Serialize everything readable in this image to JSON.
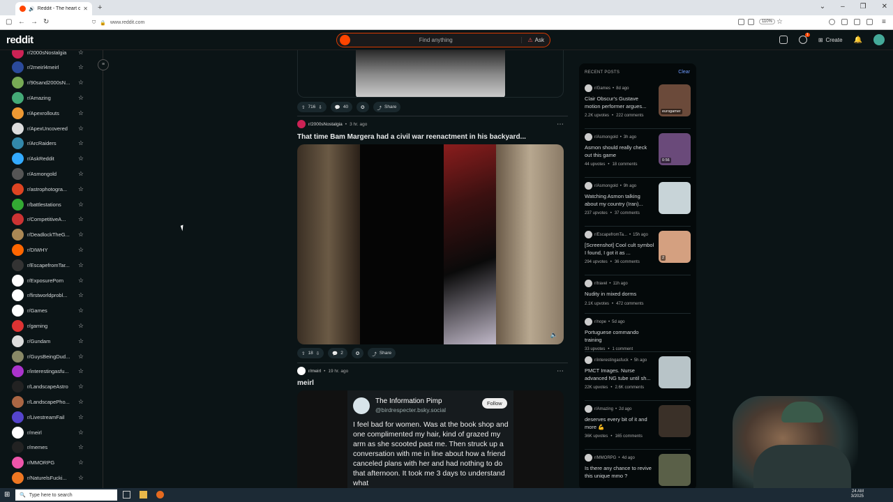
{
  "browser": {
    "tab_title": "Reddit - The heart of the in",
    "url": "www.reddit.com",
    "zoom": "110%"
  },
  "header": {
    "logo": "reddit",
    "search_placeholder": "Find anything",
    "ask_label": "Ask",
    "create_label": "Create",
    "chat_badge": "1"
  },
  "sidebar": {
    "items": [
      {
        "label": "r/2000sNostalgia",
        "color": "#c25"
      },
      {
        "label": "r/2meirl4meirl",
        "color": "#2b4a9b"
      },
      {
        "label": "r/90sand2000sN...",
        "color": "#7a5"
      },
      {
        "label": "r/Amazing",
        "color": "#4a7"
      },
      {
        "label": "r/Apexrollouts",
        "color": "#e93"
      },
      {
        "label": "r/ApexUncovered",
        "color": "#ddd"
      },
      {
        "label": "r/ArcRaiders",
        "color": "#38a"
      },
      {
        "label": "r/AskReddit",
        "color": "#3af"
      },
      {
        "label": "r/Asmongold",
        "color": "#555"
      },
      {
        "label": "r/astrophotogra...",
        "color": "#d42"
      },
      {
        "label": "r/battlestations",
        "color": "#3a3"
      },
      {
        "label": "r/CompetitiveA...",
        "color": "#c33"
      },
      {
        "label": "r/DeadlockTheG...",
        "color": "#a85"
      },
      {
        "label": "r/DIWHY",
        "color": "#f60"
      },
      {
        "label": "r/EscapefromTar...",
        "color": "#333"
      },
      {
        "label": "r/ExposurePorn",
        "color": "#fff"
      },
      {
        "label": "r/firstworldprobl...",
        "color": "#fff"
      },
      {
        "label": "r/Games",
        "color": "#fff"
      },
      {
        "label": "r/gaming",
        "color": "#d33"
      },
      {
        "label": "r/Gundam",
        "color": "#ddd"
      },
      {
        "label": "r/GuysBeingDud...",
        "color": "#886"
      },
      {
        "label": "r/interestingasfu...",
        "color": "#a3c"
      },
      {
        "label": "r/LandscapeAstro",
        "color": "#222"
      },
      {
        "label": "r/LandscapePho...",
        "color": "#a64"
      },
      {
        "label": "r/LivestreamFail",
        "color": "#54c"
      },
      {
        "label": "r/meirl",
        "color": "#fff"
      },
      {
        "label": "r/memes",
        "color": "#222"
      },
      {
        "label": "r/MMORPG",
        "color": "#e5a"
      },
      {
        "label": "r/NaturelsFucki...",
        "color": "#e72"
      }
    ]
  },
  "feed": {
    "post1": {
      "upvotes": "716",
      "comments": "40",
      "share": "Share"
    },
    "post2": {
      "subreddit": "r/2000sNostalgia",
      "time": "3 hr. ago",
      "title": "That time Bam Margera had a civil war reenactment in his backyard...",
      "upvotes": "18",
      "comments": "2",
      "share": "Share"
    },
    "post3": {
      "subreddit": "r/meirl",
      "time": "19 hr. ago",
      "title": "meirl",
      "tweet_name": "The Information Pimp",
      "tweet_handle": "@birdrespecter.bsky.social",
      "follow": "Follow",
      "tweet_text": "I feel bad for women. Was at the book shop and one complimented my hair, kind of grazed my arm as she scooted past me. Then struck up a conversation with me in line about how a friend canceled plans with her and had nothing to do that afternoon. It took me 3 days to understand what"
    }
  },
  "recent": {
    "heading": "RECENT POSTS",
    "clear": "Clear",
    "items": [
      {
        "sub": "r/Games",
        "time": "8d ago",
        "title": "Clair Obscur's Gustave motion performer argues...",
        "upvotes": "2.2K upvotes",
        "comments": "222 comments",
        "thumb": "#6b4a3a",
        "thumb_label": "eurogamer"
      },
      {
        "sub": "r/Asmongold",
        "time": "3h ago",
        "title": "Asmon should really check out this game",
        "upvotes": "44 upvotes",
        "comments": "18 comments",
        "thumb": "#6a4a7a",
        "thumb_label": "0:56"
      },
      {
        "sub": "r/Asmongold",
        "time": "9h ago",
        "title": "Watching Asmon talking about my country (Iran)...",
        "upvotes": "237 upvotes",
        "comments": "37 comments",
        "thumb": "#c8d4d8",
        "thumb_label": ""
      },
      {
        "sub": "r/EscapefromTa...",
        "time": "15h ago",
        "title": "[Screenshot] Cool cult symbol I found, I got it as ...",
        "upvotes": "294 upvotes",
        "comments": "36 comments",
        "thumb": "#d4a080",
        "thumb_label": "2"
      },
      {
        "sub": "r/travel",
        "time": "11h ago",
        "title": "Nudity in mixed dorms",
        "upvotes": "2.1K upvotes",
        "comments": "472 comments",
        "thumb": "",
        "thumb_label": ""
      },
      {
        "sub": "r/nope",
        "time": "5d ago",
        "title": "Portuguese commando training",
        "upvotes": "33 upvotes",
        "comments": "1 comment",
        "thumb": "",
        "thumb_label": ""
      },
      {
        "sub": "r/interestingasfuck",
        "time": "5h ago",
        "title": "PMCT Images. Nurse advanced NG tube until sh...",
        "upvotes": "22K upvotes",
        "comments": "2.6K comments",
        "thumb": "#b8c4c8",
        "thumb_label": ""
      },
      {
        "sub": "r/Amazing",
        "time": "2d ago",
        "title": "deserves every bit of it and more 💪",
        "upvotes": "36K upvotes",
        "comments": "165 comments",
        "thumb": "#3a3028",
        "thumb_label": ""
      },
      {
        "sub": "r/MMORPG",
        "time": "4d ago",
        "title": "Is there any chance to revive this unique mmo ?",
        "upvotes": "",
        "comments": "",
        "thumb": "#5a6048",
        "thumb_label": ""
      }
    ]
  },
  "taskbar": {
    "search_placeholder": "Type here to search",
    "time": "24 AM",
    "date": "3/2025"
  }
}
